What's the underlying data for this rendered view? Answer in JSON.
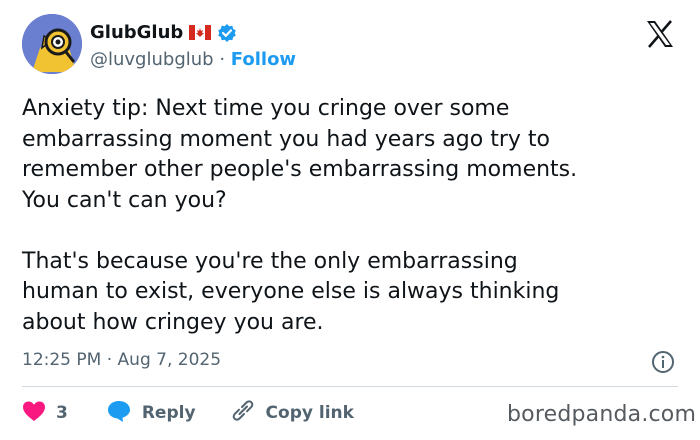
{
  "author": {
    "display_name": "GlubGlub",
    "handle": "@luvglubglub",
    "separator": "·",
    "follow_label": "Follow",
    "flag": "canada-flag-icon",
    "verified": "verified-badge-icon"
  },
  "tweet": {
    "text": "Anxiety tip: Next time you cringe over some\nembarrassing moment you had years ago try to\nremember other people's embarrassing moments.\nYou can't can you?\n\nThat's because you're the only embarrassing\nhuman to exist, everyone else is always thinking\nabout how cringey you are.",
    "time": "12:25 PM",
    "separator": "·",
    "date": "Aug 7, 2025"
  },
  "actions": {
    "like_count": "3",
    "reply_label": "Reply",
    "copy_link_label": "Copy link"
  },
  "watermark": "boredpanda.com",
  "colors": {
    "accent": "#1d9bf0",
    "like": "#f91880",
    "muted": "#536471",
    "text": "#0f1419"
  }
}
